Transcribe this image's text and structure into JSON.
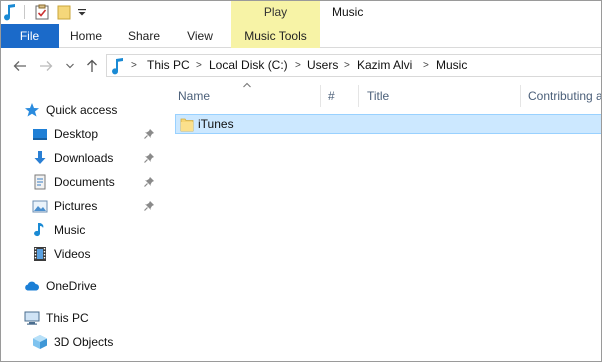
{
  "title_bar": {
    "contextual_group": "Play",
    "window_title": "Music"
  },
  "ribbon": {
    "tabs": [
      {
        "label": "File"
      },
      {
        "label": "Home"
      },
      {
        "label": "Share"
      },
      {
        "label": "View"
      },
      {
        "label": "Music Tools"
      }
    ]
  },
  "address_bar": {
    "crumbs": [
      "This PC",
      "Local Disk (C:)",
      "Users",
      "Kazim Alvi",
      "Music"
    ]
  },
  "nav_pane": {
    "items": [
      {
        "label": "Quick access",
        "icon": "star-icon"
      },
      {
        "label": "Desktop",
        "icon": "desktop-icon",
        "pinned": true
      },
      {
        "label": "Downloads",
        "icon": "download-icon",
        "pinned": true
      },
      {
        "label": "Documents",
        "icon": "document-icon",
        "pinned": true
      },
      {
        "label": "Pictures",
        "icon": "picture-icon",
        "pinned": true
      },
      {
        "label": "Music",
        "icon": "music-note-icon"
      },
      {
        "label": "Videos",
        "icon": "film-icon"
      },
      {
        "label": "OneDrive",
        "icon": "cloud-icon"
      },
      {
        "label": "This PC",
        "icon": "computer-icon"
      },
      {
        "label": "3D Objects",
        "icon": "cube-icon"
      }
    ]
  },
  "content": {
    "columns": [
      "Name",
      "#",
      "Title",
      "Contributing a"
    ],
    "files": [
      {
        "name": "iTunes",
        "type": "folder",
        "selected": true
      }
    ]
  },
  "colors": {
    "file_tab": "#1b6ac9",
    "tools_highlight": "#f7f3a6",
    "selection": "#cce8ff",
    "accent_blue": "#0078d7"
  }
}
